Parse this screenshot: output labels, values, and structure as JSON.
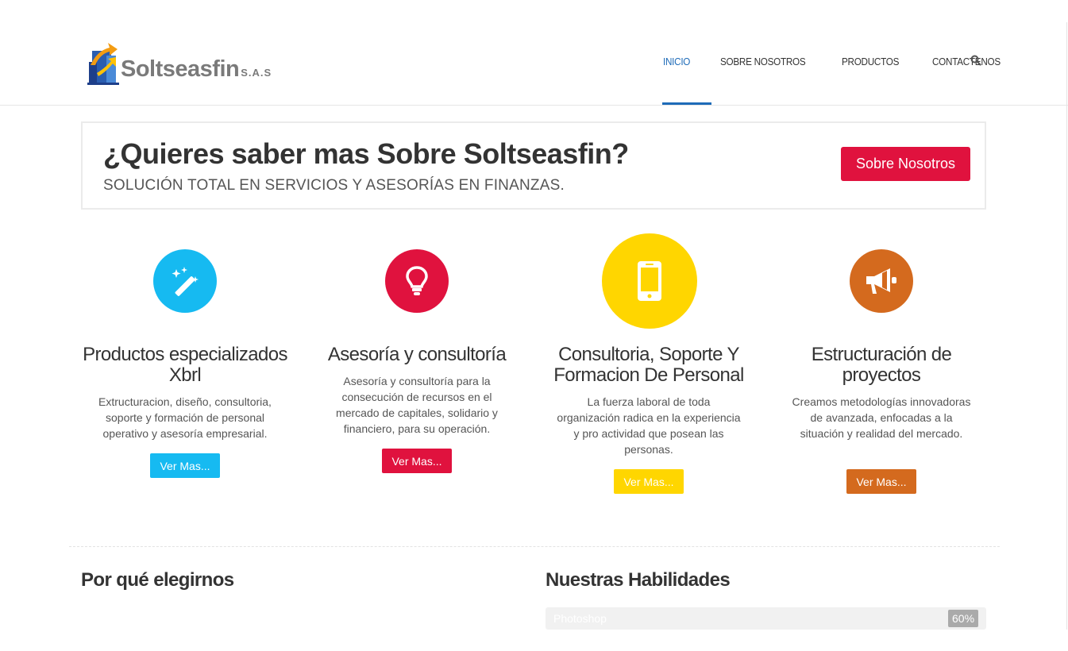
{
  "header": {
    "logo_text": "Soltseasfin",
    "logo_sub": "S.A.S",
    "nav": [
      "INICIO",
      "SOBRE NOSOTROS",
      "PRODUCTOS",
      "CONTACTENOS"
    ],
    "active_color": "#1e6bb8",
    "search_icon": "search-icon"
  },
  "cta": {
    "title": "¿Quieres saber mas Sobre Soltseasfin?",
    "subtitle": "SOLUCIÓN TOTAL EN SERVICIOS Y ASESORÍAS EN FINANZAS.",
    "button": "Sobre Nosotros",
    "button_color": "#e0123e"
  },
  "features": [
    {
      "icon": "magic-wand-icon",
      "color": "#16baf1",
      "title": "Productos especializados Xbrl",
      "text": "Extructuracion, diseño, consultoria, soporte y formación de personal operativo y asesoría empresarial.",
      "button": "Ver Mas..."
    },
    {
      "icon": "lightbulb-icon",
      "color": "#e0123e",
      "title": "Asesoría y consultoría",
      "text": "Asesoría y consultoría para la consecución de recursos en el mercado de capitales, solidario y financiero, para su operación.",
      "button": "Ver Mas..."
    },
    {
      "icon": "mobile-phone-icon",
      "color": "#ffd600",
      "title": "Consultoria, Soporte Y Formacion De Personal",
      "text": "La fuerza laboral de toda organización radica en la experiencia y pro actividad que posean las personas.",
      "button": "Ver Mas..."
    },
    {
      "icon": "megaphone-icon",
      "color": "#d46a1e",
      "title": "Estructuración de proyectos",
      "text": "Creamos metodologías innovadoras de avanzada, enfocadas a la situación y realidad del mercado.",
      "button": "Ver Mas..."
    }
  ],
  "why": {
    "title": "Por qué elegirnos"
  },
  "skills": {
    "title": "Nuestras Habilidades",
    "items": [
      {
        "name": "Photoshop",
        "percent": "60%"
      }
    ]
  }
}
